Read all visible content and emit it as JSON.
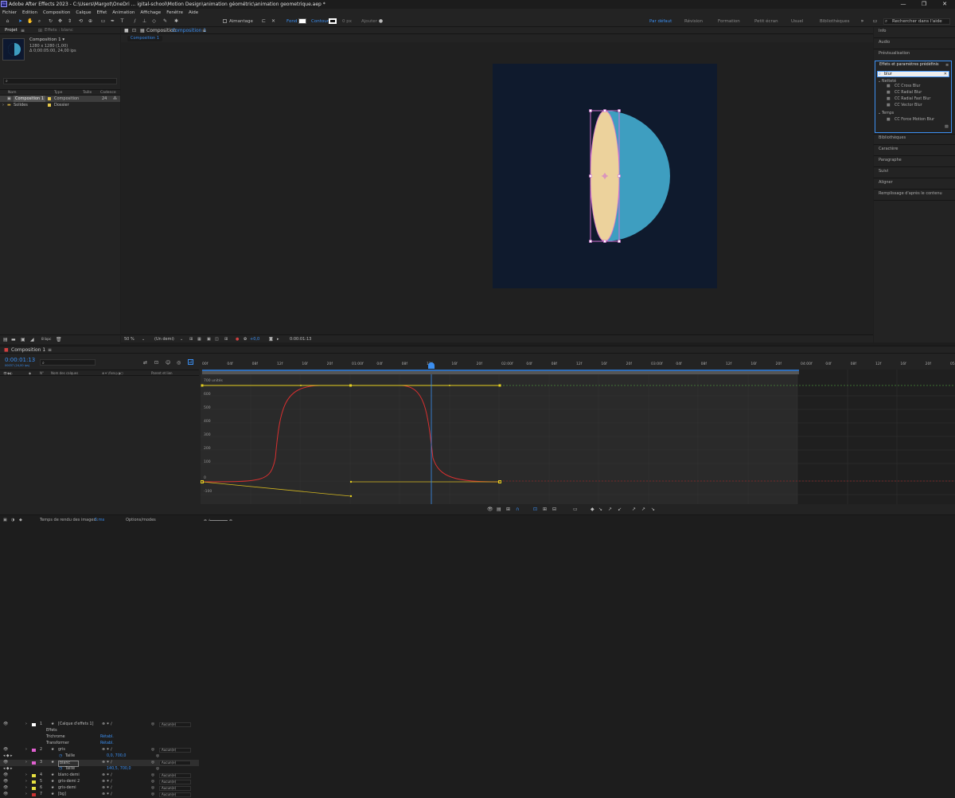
{
  "window": {
    "title": "Adobe After Effects 2023 - C:\\Users\\Margot\\OneDri ... igital-school\\Motion Design\\animation géométric\\animation geometrique.aep *",
    "controls": [
      "—",
      "❐",
      "✕"
    ]
  },
  "menu": [
    "Fichier",
    "Edition",
    "Composition",
    "Calque",
    "Effet",
    "Animation",
    "Affichage",
    "Fenêtre",
    "Aide"
  ],
  "toolbar": {
    "snap_label": "Aimantage",
    "fill_label": "Fond",
    "stroke_label": "Contour",
    "stroke_px": "0 px",
    "add_label": "Ajouter :",
    "workspaces": [
      "Par défaut",
      "Révision",
      "Formation",
      "Petit écran",
      "Usuel",
      "Bibliothèques"
    ],
    "search_help": "Rechercher dans l'aide"
  },
  "project": {
    "tabs": [
      "Projet",
      "Effets : blanc"
    ],
    "comp_name": "Composition 1 ▾",
    "comp_size": "1280 x 1280 (1,00)",
    "comp_duration": "Δ 0;00:05:00, 24,00 ips",
    "columns": [
      "Nom",
      "Type",
      "Taille",
      "Cadence"
    ],
    "items": [
      {
        "name": "Composition 1",
        "type": "Composition",
        "rate": "24",
        "color": "#e6c84a"
      },
      {
        "name": "Solides",
        "type": "Dossier",
        "rate": "",
        "color": "#e6c84a"
      }
    ],
    "bpc": "8 bpc"
  },
  "viewer": {
    "tab_label": "Composition",
    "tab_name": "Composition 1",
    "crumb": "Composition 1",
    "zoom": "50 %",
    "resolution": "(Un demi)",
    "exposure": "+0,0",
    "timecode": "0:00:01:13"
  },
  "right_panel": {
    "items_top": [
      "Info",
      "Audio",
      "Prévisualisation"
    ],
    "effects_title": "Effets et paramètres prédéfinis",
    "effects_search": "blur",
    "groups": [
      {
        "name": "Netteté",
        "items": [
          "CC Cross Blur",
          "CC Radial Blur",
          "CC Radial Fast Blur",
          "CC Vector Blur"
        ]
      },
      {
        "name": "Temps",
        "items": [
          "CC Force Motion Blur"
        ]
      }
    ],
    "items_bottom": [
      "Bibliothèques",
      "Caractère",
      "Paragraphe",
      "Suivi",
      "Aligner",
      "Remplissage d'après le contenu"
    ]
  },
  "timeline": {
    "tab": "Composition 1",
    "timecode": "0:00:01:13",
    "fps": "00037 (24,00 ips)",
    "columns": [
      "N°",
      "Nom des calques",
      "Parent et lien"
    ],
    "layers": [
      {
        "num": "1",
        "name": "[Calque d'effets 1]",
        "color": "#ffffff",
        "parent": "Aucun(e)",
        "sub": false
      },
      {
        "num": "",
        "name": "Effets",
        "color": "",
        "parent": "",
        "sub": true
      },
      {
        "num": "",
        "name": "Trichrome",
        "color": "",
        "parent": "Rétabl.",
        "sub": true
      },
      {
        "num": "",
        "name": "Transformer",
        "color": "",
        "parent": "Rétabl.",
        "sub": true
      },
      {
        "num": "2",
        "name": "gris",
        "color": "#e060d0",
        "parent": "Aucun(e)",
        "sub": false
      },
      {
        "num": "",
        "name": "Taille",
        "color": "",
        "parent": "0,0, 700,0",
        "sub": true
      },
      {
        "num": "3",
        "name": "blanc",
        "color": "#e060d0",
        "parent": "Aucun(e)",
        "sub": false
      },
      {
        "num": "",
        "name": "Taille",
        "color": "",
        "parent": "140,5, 700,0",
        "sub": true
      },
      {
        "num": "4",
        "name": "blanc-demi",
        "color": "#e6e040",
        "parent": "Aucun(e)",
        "sub": false
      },
      {
        "num": "5",
        "name": "gris-demi 2",
        "color": "#e6e040",
        "parent": "Aucun(e)",
        "sub": false
      },
      {
        "num": "6",
        "name": "gris-demi",
        "color": "#e6e040",
        "parent": "Aucun(e)",
        "sub": false
      },
      {
        "num": "7",
        "name": "[bg]",
        "color": "#c83232",
        "parent": "Aucun(e)",
        "sub": false
      }
    ],
    "ruler": [
      "00f",
      "04f",
      "08f",
      "12f",
      "16f",
      "20f",
      "01:00f",
      "04f",
      "08f",
      "12f",
      "16f",
      "20f",
      "02:00f",
      "04f",
      "08f",
      "12f",
      "16f",
      "20f",
      "03:00f",
      "04f",
      "08f",
      "12f",
      "16f",
      "20f",
      "04:00f",
      "04f",
      "08f",
      "12f",
      "16f",
      "20f",
      "05:0"
    ],
    "graph_unit": "700 unités",
    "y_labels": [
      "600",
      "500",
      "400",
      "300",
      "200",
      "100",
      "0",
      "-100"
    ],
    "render_time_label": "Temps de rendu des images :",
    "render_time_value": "5 ms",
    "options_label": "Options/modes"
  }
}
